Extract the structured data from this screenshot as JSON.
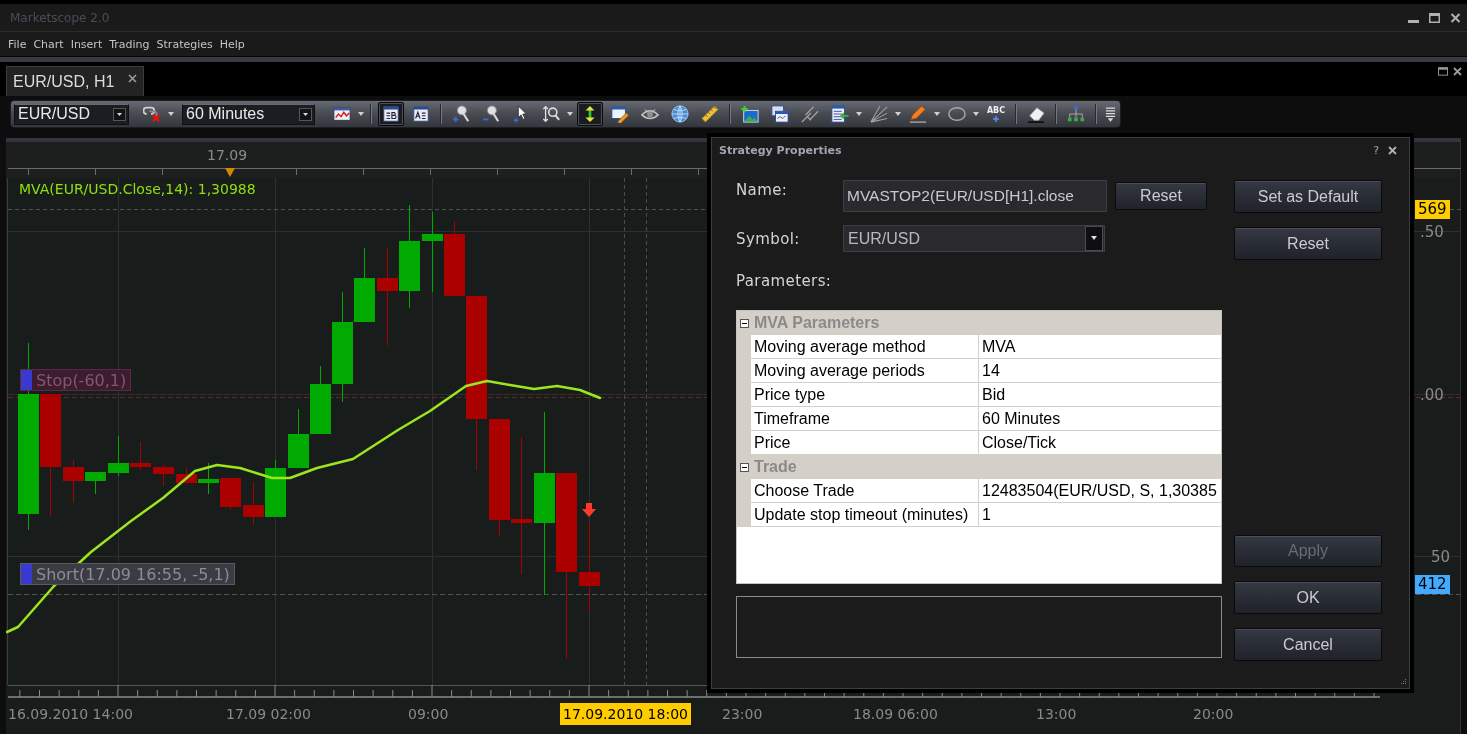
{
  "window": {
    "title": "Marketscope 2.0"
  },
  "menu": [
    "File",
    "Chart",
    "Insert",
    "Trading",
    "Strategies",
    "Help"
  ],
  "tabs": [
    {
      "label": "EUR/USD, H1",
      "selected": true
    }
  ],
  "toolbar": {
    "symbol": "EUR/USD",
    "timeframe": "60 Minutes",
    "buttons": [
      {
        "selected": false,
        "dropdown": true
      },
      {
        "selected": false,
        "dropdown": true
      },
      {
        "selected": true,
        "dropdown": false
      },
      {
        "selected": false,
        "dropdown": false
      },
      {
        "selected": false,
        "dropdown": false
      },
      {
        "selected": false,
        "dropdown": false
      },
      {
        "selected": false,
        "dropdown": false
      },
      {
        "selected": false,
        "dropdown": true
      },
      {
        "selected": true,
        "dropdown": false
      },
      {
        "selected": false,
        "dropdown": false
      },
      {
        "selected": false,
        "dropdown": false
      },
      {
        "selected": false,
        "dropdown": false
      },
      {
        "selected": false,
        "dropdown": false
      },
      {
        "selected": false,
        "dropdown": false
      },
      {
        "selected": false,
        "dropdown": false
      },
      {
        "selected": false,
        "dropdown": false
      },
      {
        "selected": false,
        "dropdown": true
      },
      {
        "selected": false,
        "dropdown": true
      },
      {
        "selected": false,
        "dropdown": true
      },
      {
        "selected": false,
        "dropdown": true
      },
      {
        "selected": false,
        "dropdown": false,
        "label": "ABC"
      },
      {
        "selected": false,
        "dropdown": false
      },
      {
        "selected": false,
        "dropdown": false
      },
      {
        "selected": false,
        "dropdown": false
      }
    ]
  },
  "chart": {
    "date_marker": "17.09",
    "indicator": "MVA(EUR/USD.Close,14): 1,30988",
    "order_tags": [
      {
        "kind": "stop",
        "text": "Stop(-60,1)"
      },
      {
        "kind": "position",
        "text": "Short(17.09 16:55, -5,1)"
      }
    ],
    "price_labels": [
      {
        "kind": "marker",
        "text": "569",
        "color": "#ffcc00"
      },
      {
        "kind": "tick",
        "text": ".50"
      },
      {
        "kind": "tick",
        "text": ".00"
      },
      {
        "kind": "tick",
        "text": "50"
      },
      {
        "kind": "marker",
        "text": "412",
        "color": "#44aaff"
      }
    ],
    "time_labels": [
      {
        "kind": "tick",
        "text": "16.09.2010 14:00"
      },
      {
        "kind": "tick",
        "text": "17.09 02:00"
      },
      {
        "kind": "tick",
        "text": "09:00"
      },
      {
        "kind": "cursor",
        "text": "17.09.2010 18:00"
      },
      {
        "kind": "tick",
        "text": "23:00"
      },
      {
        "kind": "tick",
        "text": "18.09 06:00"
      },
      {
        "kind": "tick",
        "text": "13:00"
      },
      {
        "kind": "tick",
        "text": "20:00"
      }
    ]
  },
  "dialog": {
    "title": "Strategy Properties",
    "help": "?",
    "name": {
      "label": "Name:",
      "value": "MVASTOP2(EUR/USD[H1].close",
      "button": "Reset"
    },
    "symbol": {
      "label": "Symbol:",
      "value": "EUR/USD"
    },
    "parameters_label": "Parameters:",
    "groups": [
      {
        "title": "MVA Parameters",
        "expanded": true,
        "rows": [
          {
            "name": "Moving average method",
            "value": "MVA"
          },
          {
            "name": "Moving average periods",
            "value": "14"
          },
          {
            "name": "Price type",
            "value": "Bid"
          },
          {
            "name": "Timeframe",
            "value": "60 Minutes"
          },
          {
            "name": "Price",
            "value": "Close/Tick"
          }
        ]
      },
      {
        "title": "Trade",
        "expanded": true,
        "rows": [
          {
            "name": "Choose Trade",
            "value": "12483504(EUR/USD, S, 1,30385"
          },
          {
            "name": "Update stop timeout (minutes)",
            "value": "1"
          }
        ]
      }
    ],
    "buttons": [
      {
        "label": "Set as Default",
        "disabled": false
      },
      {
        "label": "Reset",
        "disabled": false
      },
      {
        "label": "Apply",
        "disabled": true
      },
      {
        "label": "OK",
        "disabled": false
      },
      {
        "label": "Cancel",
        "disabled": false
      }
    ]
  }
}
